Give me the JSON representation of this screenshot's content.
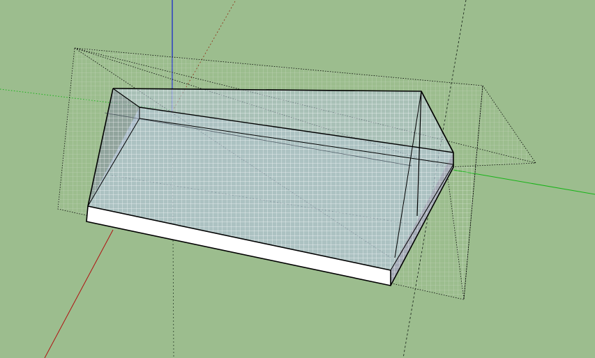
{
  "viewport": {
    "background_color": "#9cbd8e",
    "axis_colors": {
      "red": "#b01010",
      "green": "#18b418",
      "blue": "#1020d0"
    },
    "face_colors": {
      "glass": "#b4c4d8",
      "base": "#ffffff",
      "side_shadow": "#8c96a6"
    },
    "grid_color": "#ffffff",
    "edge_color": "#000000",
    "guide_style": "dashed"
  }
}
